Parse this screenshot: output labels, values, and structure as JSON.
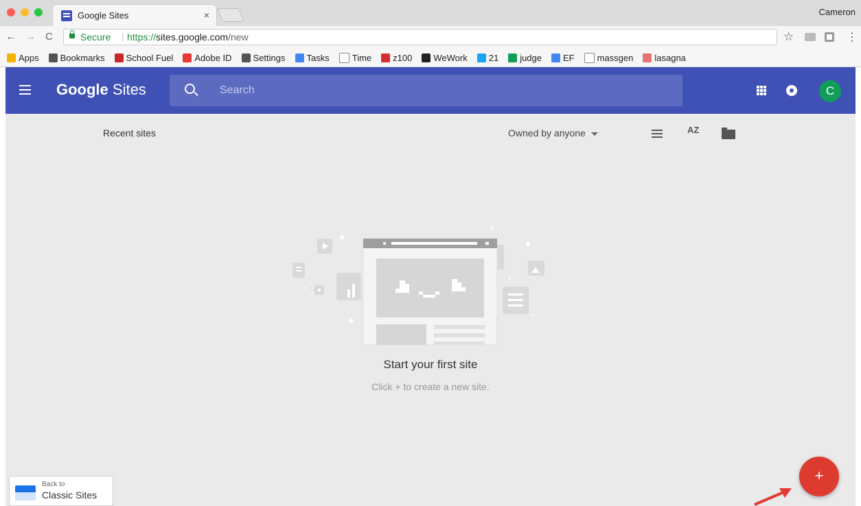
{
  "browser": {
    "tab_title": "Google Sites",
    "tab_close": "×",
    "profile_name": "Cameron",
    "security_label": "Secure",
    "url_scheme": "https://",
    "url_host": "sites.google.com",
    "url_path": "/new",
    "separator": "|",
    "back": "←",
    "forward": "→",
    "reload": "C",
    "star": "☆",
    "menu": "⋮"
  },
  "bookmarks": [
    {
      "label": "Apps",
      "icon": "apps-grid-icon",
      "color": "#f4b400"
    },
    {
      "label": "Bookmarks",
      "icon": "star-icon",
      "color": "#555555"
    },
    {
      "label": "School Fuel",
      "icon": "school-fuel-icon",
      "color": "#c62828"
    },
    {
      "label": "Adobe ID",
      "icon": "adobe-icon",
      "color": "#e53935"
    },
    {
      "label": "Settings",
      "icon": "gear-icon",
      "color": "#555555"
    },
    {
      "label": "Tasks",
      "icon": "doc-icon",
      "color": "#4285f4"
    },
    {
      "label": "Time",
      "icon": "page-icon",
      "color": "#ffffff"
    },
    {
      "label": "z100",
      "icon": "iheart-icon",
      "color": "#d32f2f"
    },
    {
      "label": "WeWork",
      "icon": "wework-icon",
      "color": "#222222"
    },
    {
      "label": "21",
      "icon": "twitter-icon",
      "color": "#1da1f2"
    },
    {
      "label": "judge",
      "icon": "sheet-icon",
      "color": "#0f9d58"
    },
    {
      "label": "EF",
      "icon": "doc-icon",
      "color": "#4285f4"
    },
    {
      "label": "massgen",
      "icon": "page-icon",
      "color": "#ffffff"
    },
    {
      "label": "lasagna",
      "icon": "cocktail-icon",
      "color": "#e57373"
    }
  ],
  "app": {
    "brand_google": "Google",
    "brand_sites": " Sites",
    "search_placeholder": "Search",
    "avatar_letter": "C",
    "recent_label": "Recent sites",
    "owner_filter": "Owned by anyone",
    "sort_label": "AZ",
    "empty_title": "Start your first site",
    "empty_subtitle": "Click + to create a new site.",
    "fab_label": "+",
    "classic_small": "Back to",
    "classic_big": "Classic Sites"
  },
  "colors": {
    "header": "#3f51b5",
    "search_bg": "#5c6bc0",
    "fab": "#dd3b2f",
    "avatar": "#0f9d58",
    "secure_green": "#1e8e3e",
    "arrow": "#e53935"
  }
}
